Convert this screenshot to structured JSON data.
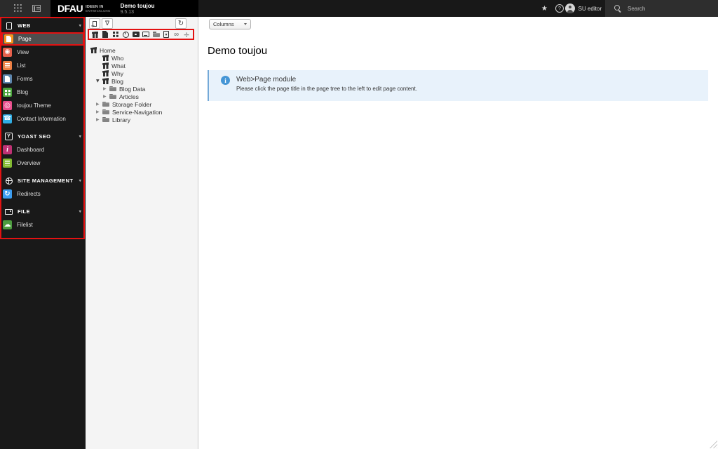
{
  "colors": {
    "annotation": "#e31212",
    "topbar_bg": "#181818",
    "sidebar_bg": "#191919",
    "selected_row_bg": "#4e4e4e",
    "tree_bg": "#f4f4f4",
    "callout_bg": "#e8f2fb",
    "callout_border": "#74a9d8",
    "info_icon": "#4596d6"
  },
  "topbar": {
    "logo_text": "DFAU",
    "logo_tagline_line1": "IDEEN IN",
    "logo_tagline_line2": "ENTWICKLUNG",
    "site_title": "Demo toujou",
    "site_version": "9.5.13",
    "user_label": "SU editor",
    "search_label": "Search"
  },
  "sidebar": {
    "sections": [
      {
        "label": "WEB",
        "items": [
          {
            "label": "Page",
            "icon": "page-module-icon",
            "color": "#f7931e",
            "selected": true
          },
          {
            "label": "View",
            "icon": "view-module-icon",
            "color": "#e8604c"
          },
          {
            "label": "List",
            "icon": "list-module-icon",
            "color": "#ee8145"
          },
          {
            "label": "Forms",
            "icon": "forms-module-icon",
            "color": "#5e87ae"
          },
          {
            "label": "Blog",
            "icon": "blog-module-icon",
            "color": "#4aa53c"
          },
          {
            "label": "toujou Theme",
            "icon": "theme-module-icon",
            "color": "#ea4f8d"
          },
          {
            "label": "Contact Information",
            "icon": "contact-module-icon",
            "color": "#31aee4"
          }
        ]
      },
      {
        "label": "YOAST SEO",
        "items": [
          {
            "label": "Dashboard",
            "icon": "yoast-dashboard-icon",
            "color": "#bf3173"
          },
          {
            "label": "Overview",
            "icon": "yoast-overview-icon",
            "color": "#84bb33"
          }
        ]
      },
      {
        "label": "SITE MANAGEMENT",
        "items": [
          {
            "label": "Redirects",
            "icon": "redirects-module-icon",
            "color": "#3d9df0"
          }
        ]
      },
      {
        "label": "FILE",
        "items": [
          {
            "label": "Filelist",
            "icon": "filelist-module-icon",
            "color": "#4d9c3f"
          }
        ]
      }
    ]
  },
  "pagetree": {
    "toolbar": [
      "new-page-button",
      "filter-button",
      "refresh-button"
    ],
    "page_types": [
      "toujou-page",
      "standard-page",
      "grid-page",
      "timed-page",
      "video-page",
      "form-page",
      "folder",
      "shortcut-page",
      "external-link-page",
      "divider"
    ],
    "items": [
      {
        "label": "Home",
        "depth": 0,
        "icon": "page",
        "arrow": ""
      },
      {
        "label": "Who",
        "depth": 1,
        "icon": "page",
        "arrow": ""
      },
      {
        "label": "What",
        "depth": 1,
        "icon": "page",
        "arrow": ""
      },
      {
        "label": "Why",
        "depth": 1,
        "icon": "page",
        "arrow": ""
      },
      {
        "label": "Blog",
        "depth": 1,
        "icon": "page",
        "arrow": "expanded"
      },
      {
        "label": "Blog Data",
        "depth": 2,
        "icon": "folder",
        "arrow": "collapsed"
      },
      {
        "label": "Articles",
        "depth": 2,
        "icon": "folder",
        "arrow": "collapsed"
      },
      {
        "label": "Storage Folder",
        "depth": 1,
        "icon": "folder",
        "arrow": "collapsed"
      },
      {
        "label": "Service-Navigation",
        "depth": 1,
        "icon": "folder",
        "arrow": "collapsed"
      },
      {
        "label": "Library",
        "depth": 1,
        "icon": "folder",
        "arrow": "collapsed"
      }
    ]
  },
  "main": {
    "columns_select": "Columns",
    "page_title": "Demo toujou",
    "callout": {
      "title": "Web>Page module",
      "body": "Please click the page title in the page tree to the left to edit page content."
    }
  }
}
